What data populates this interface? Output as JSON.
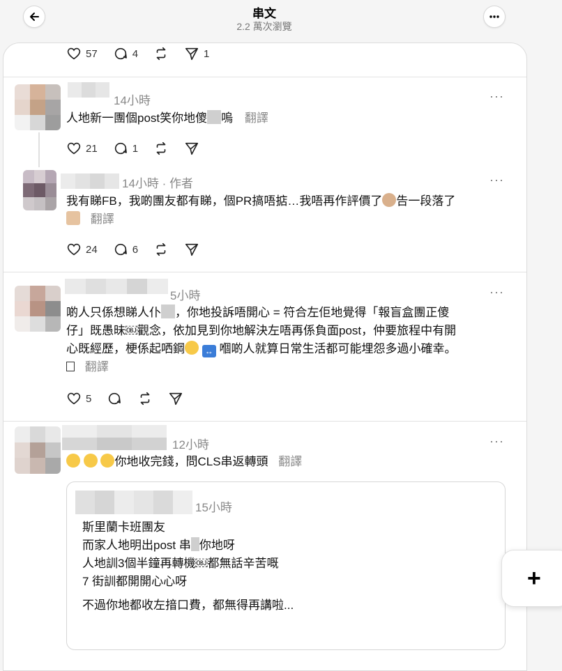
{
  "header": {
    "title": "串文",
    "views": "2.2 萬次瀏覽"
  },
  "top_actions": {
    "likes": "57",
    "replies": "4",
    "shares": "1"
  },
  "posts": [
    {
      "time": "14小時",
      "text_a": "人地新一團個post笑你地傻",
      "text_b": "嗚",
      "translate": "翻譯",
      "likes": "21",
      "replies": "1"
    },
    {
      "time": "14小時 · 作者",
      "line1": "我有睇FB，我啲團友都有睇，個PR搞唔掂…我唔再作評價了",
      "line1_tail": "告一段落了",
      "translate": "翻譯",
      "likes": "24",
      "replies": "6"
    },
    {
      "time": "5小時",
      "line1a": "啲人只係想睇人仆",
      "line1b": "，你地投訴唔開心 = 符合左佢地覺得「報盲盒團正傻",
      "line2": "仔」既愚昧￼觀念，依加見到你地解決左唔再係負面post，仲要旅程中有開",
      "line3a": "心既經歷，梗係起哂鋼",
      "line3b": "嗰啲人就算日常生活都可能埋怨多過小確幸。",
      "translate": "翻譯",
      "likes": "5"
    },
    {
      "time": "12小時",
      "text": "你地收完錢，問CLS串返轉頭",
      "translate": "翻譯"
    }
  ],
  "quote": {
    "time": "15小時",
    "lines": [
      "斯里蘭卡班團友",
      "而家人地明出post 串",
      "人地訓3個半鐘再轉機￼都無話辛苦嘅",
      "7 街訓都開開心心呀",
      "不過你地都收左揞口費，都無得再講啦..."
    ],
    "line2_tail": "你地呀"
  },
  "fab": {
    "label": "+"
  },
  "colors": {
    "accent_blue": "#3b7dd8",
    "divider": "#e2e2e2",
    "muted": "#888888"
  }
}
